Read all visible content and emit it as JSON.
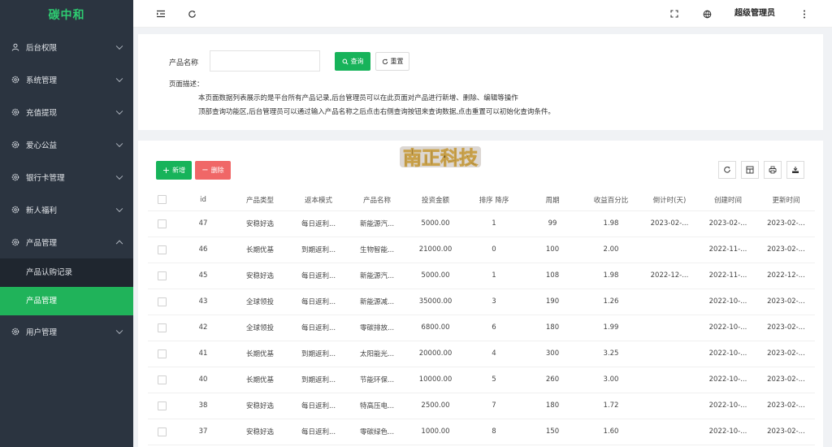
{
  "brand": "碳中和",
  "sidebar": {
    "items": [
      {
        "label": "后台权限",
        "icon": "user-icon"
      },
      {
        "label": "系统管理",
        "icon": "gear-icon"
      },
      {
        "label": "充值提现",
        "icon": "gear-icon"
      },
      {
        "label": "爱心公益",
        "icon": "gear-icon"
      },
      {
        "label": "银行卡管理",
        "icon": "gear-icon"
      },
      {
        "label": "新人福利",
        "icon": "gear-icon"
      },
      {
        "label": "产品管理",
        "icon": "gear-icon"
      },
      {
        "label": "用户管理",
        "icon": "gear-icon"
      }
    ],
    "submenu": [
      {
        "label": "产品认购记录"
      },
      {
        "label": "产品管理"
      }
    ]
  },
  "header": {
    "user": "超级管理员"
  },
  "search": {
    "label": "产品名称",
    "value": "",
    "placeholder": "",
    "query_btn": "查询",
    "reset_btn": "重置",
    "desc_title": "页面描述：",
    "desc_line1": "本页面数据列表展示的是平台所有产品记录,后台管理员可以在此页面对产品进行新增、删除、编辑等操作",
    "desc_line2": "顶部查询功能区,后台管理员可以通过输入产品名称之后点击右侧查询按钮来查询数据,点击重置可以初始化查询条件。"
  },
  "toolbar": {
    "add_btn": "新增",
    "delete_btn": "删除"
  },
  "logo_text": "南正科技",
  "table": {
    "headers": [
      "id",
      "产品类型",
      "返本模式",
      "产品名称",
      "投资金额",
      "排序 降序",
      "周期",
      "收益百分比",
      "倒计时(天)",
      "创建时间",
      "更新时间"
    ],
    "rows": [
      [
        "47",
        "安稳好选",
        "每日返利...",
        "新能源汽...",
        "5000.00",
        "1",
        "99",
        "1.98",
        "2023-02-...",
        "2023-02-...",
        "2023-02-..."
      ],
      [
        "46",
        "长期优基",
        "到期返利...",
        "生物智能...",
        "21000.00",
        "0",
        "100",
        "2.00",
        "",
        "2022-11-...",
        "2023-02-..."
      ],
      [
        "45",
        "安稳好选",
        "每日返利...",
        "新能源汽...",
        "5000.00",
        "1",
        "108",
        "1.98",
        "2022-12-...",
        "2022-11-...",
        "2022-12-..."
      ],
      [
        "43",
        "全球领投",
        "每日返利...",
        "新能源减...",
        "35000.00",
        "3",
        "190",
        "1.26",
        "",
        "2022-10-...",
        "2023-02-..."
      ],
      [
        "42",
        "全球领投",
        "每日返利...",
        "零碳排放...",
        "6800.00",
        "6",
        "180",
        "1.99",
        "",
        "2022-10-...",
        "2023-02-..."
      ],
      [
        "41",
        "长期优基",
        "到期返利...",
        "太阳能光...",
        "20000.00",
        "4",
        "300",
        "3.25",
        "",
        "2022-10-...",
        "2023-02-..."
      ],
      [
        "40",
        "长期优基",
        "到期返利...",
        "节能环保...",
        "10000.00",
        "5",
        "260",
        "3.00",
        "",
        "2022-10-...",
        "2023-02-..."
      ],
      [
        "38",
        "安稳好选",
        "每日返利...",
        "特高压电...",
        "2500.00",
        "7",
        "180",
        "1.72",
        "",
        "2022-10-...",
        "2023-02-..."
      ],
      [
        "37",
        "安稳好选",
        "每日返利...",
        "零碳绿色...",
        "1000.00",
        "8",
        "150",
        "1.60",
        "",
        "2022-10-...",
        "2023-02-..."
      ]
    ]
  }
}
